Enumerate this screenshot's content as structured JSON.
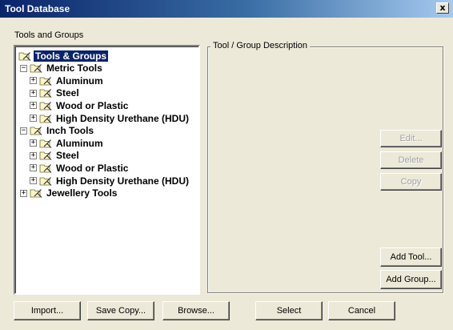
{
  "window": {
    "title": "Tool Database",
    "close_label": "x"
  },
  "tools_label": "Tools and Groups",
  "description_label": "Tool / Group Description",
  "tree": [
    {
      "label": "Tools & Groups",
      "level": 0,
      "expander": "",
      "selected": true
    },
    {
      "label": "Metric Tools",
      "level": 1,
      "expander": "minus"
    },
    {
      "label": "Aluminum",
      "level": 2,
      "expander": "plus"
    },
    {
      "label": "Steel",
      "level": 2,
      "expander": "plus"
    },
    {
      "label": "Wood or Plastic",
      "level": 2,
      "expander": "plus"
    },
    {
      "label": "High Density Urethane (HDU)",
      "level": 2,
      "expander": "plus"
    },
    {
      "label": "Inch Tools",
      "level": 1,
      "expander": "minus"
    },
    {
      "label": "Aluminum",
      "level": 2,
      "expander": "plus"
    },
    {
      "label": "Steel",
      "level": 2,
      "expander": "plus"
    },
    {
      "label": "Wood or Plastic",
      "level": 2,
      "expander": "plus"
    },
    {
      "label": "High Density Urethane (HDU)",
      "level": 2,
      "expander": "plus"
    },
    {
      "label": "Jewellery Tools",
      "level": 1,
      "expander": "plus"
    }
  ],
  "side_buttons": {
    "edit": "Edit...",
    "delete": "Delete",
    "copy": "Copy",
    "add_tool": "Add Tool...",
    "add_group": "Add Group..."
  },
  "bottom_buttons": {
    "import": "Import...",
    "save_copy": "Save Copy...",
    "browse": "Browse...",
    "select": "Select",
    "cancel": "Cancel"
  },
  "icon": "folder-tools-icon"
}
